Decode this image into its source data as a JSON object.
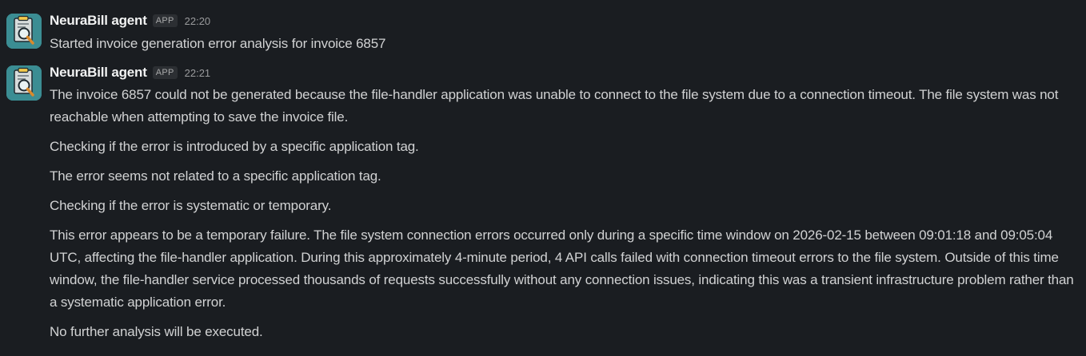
{
  "messages": [
    {
      "author": "NeuraBill agent",
      "badge": "APP",
      "time": "22:20",
      "paragraphs": [
        "Started invoice generation error analysis for invoice 6857"
      ]
    },
    {
      "author": "NeuraBill agent",
      "badge": "APP",
      "time": "22:21",
      "paragraphs": [
        "The invoice 6857 could not be generated because the file-handler application was unable to connect to the file system due to a connection timeout. The file system was not reachable when attempting to save the invoice file.",
        "Checking if the error is introduced by a specific application tag.",
        "The error seems not related to a specific application tag.",
        "Checking if the error is systematic or temporary.",
        "This error appears to be a temporary failure. The file system connection errors occurred only during a specific time window on 2026-02-15 between 09:01:18 and 09:05:04 UTC, affecting the file-handler application. During this approximately 4-minute period, 4 API calls failed with connection timeout errors to the file system. Outside of this time window, the file-handler service processed thousands of requests successfully without any connection issues, indicating this was a transient infrastructure problem rather than a systematic application error.",
        "No further analysis will be executed."
      ]
    }
  ],
  "avatar_icon": "invoice-magnifier-icon",
  "colors": {
    "background": "#1a1d21",
    "avatar": "#3b8d93",
    "text": "#d1d2d3",
    "author": "#f1f2f2",
    "muted": "#9a9b9d"
  }
}
